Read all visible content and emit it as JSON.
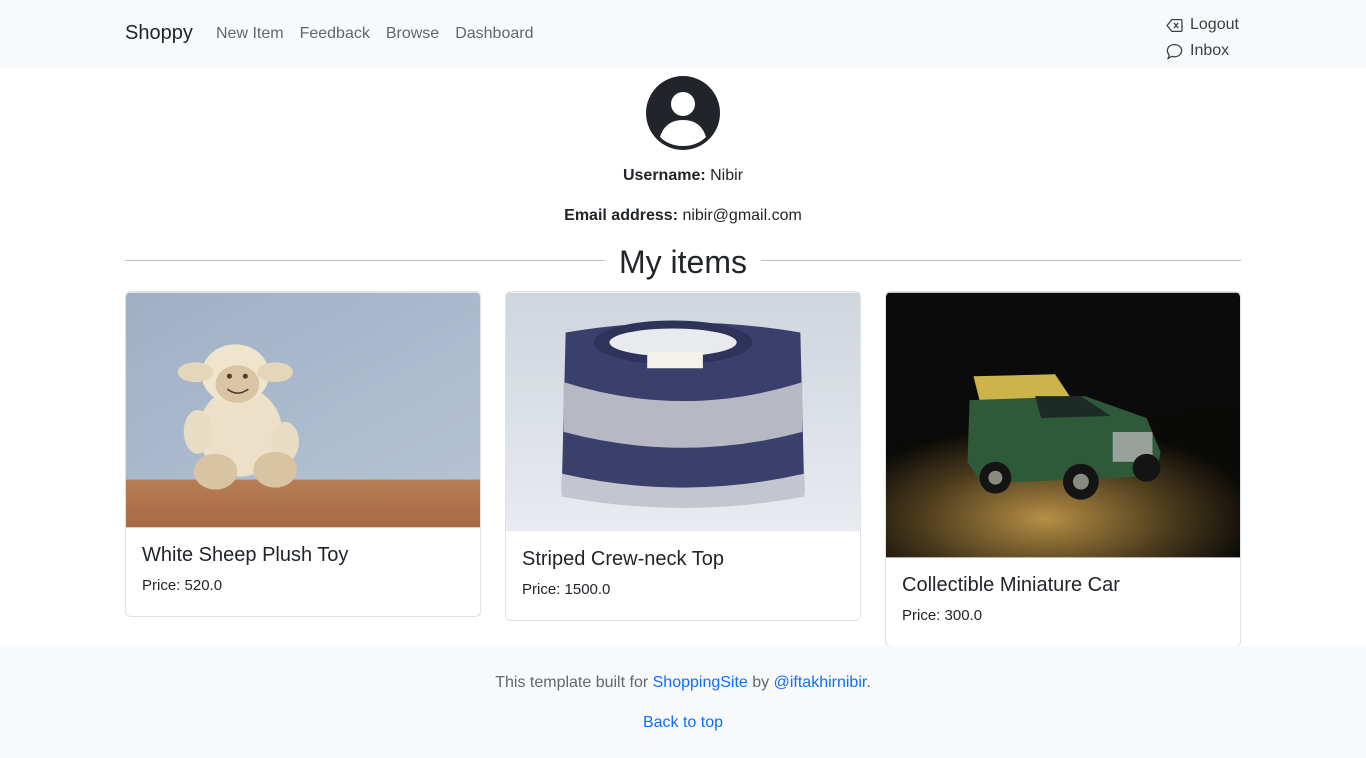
{
  "navbar": {
    "brand": "Shoppy",
    "links": [
      "New Item",
      "Feedback",
      "Browse",
      "Dashboard"
    ],
    "logout_label": "Logout",
    "inbox_label": "Inbox",
    "logout_icon": "backspace-icon",
    "inbox_icon": "chat-icon"
  },
  "profile": {
    "avatar_icon": "person-circle-icon",
    "username_label": "Username:",
    "username": "Nibir",
    "email_label": "Email address:",
    "email": "nibir@gmail.com"
  },
  "section": {
    "title": "My items"
  },
  "items": [
    {
      "title": "White Sheep Plush Toy",
      "price": "Price: 520.0",
      "image": "plush-sheep-photo"
    },
    {
      "title": "Striped Crew-neck Top",
      "price": "Price: 1500.0",
      "image": "striped-sweater-photo"
    },
    {
      "title": "Collectible Miniature Car",
      "price": "Price: 300.0",
      "image": "toy-car-photo"
    }
  ],
  "footer": {
    "prefix": "This template built for ",
    "site_link": "ShoppingSite",
    "by": " by ",
    "author_link": "@iftakhirnibir",
    "suffix": ".",
    "back_to_top": "Back to top"
  },
  "colors": {
    "link": "#0d6efd",
    "navbar_bg": "#f8f9fa"
  }
}
